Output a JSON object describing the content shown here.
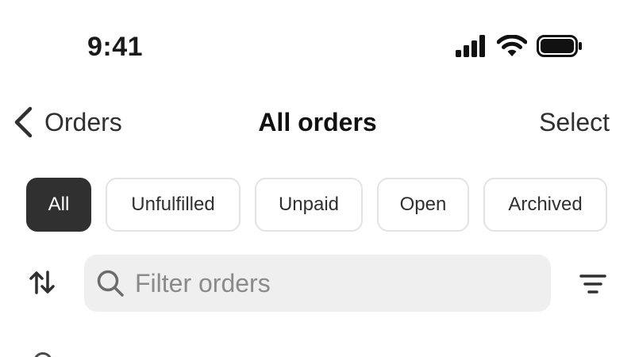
{
  "status_bar": {
    "time": "9:41",
    "icons": [
      "signal-icon",
      "wifi-icon",
      "battery-icon"
    ]
  },
  "nav": {
    "back_label": "Orders",
    "title": "All orders",
    "action_label": "Select"
  },
  "filters": {
    "selected": "All",
    "chips": [
      {
        "label": "All"
      },
      {
        "label": "Unfulfilled"
      },
      {
        "label": "Unpaid"
      },
      {
        "label": "Open"
      },
      {
        "label": "Archived"
      }
    ]
  },
  "search": {
    "placeholder": "Filter orders",
    "value": ""
  },
  "colors": {
    "active_chip_bg": "#303030",
    "search_bg": "#efefef",
    "chip_border": "#e3e3e3"
  }
}
